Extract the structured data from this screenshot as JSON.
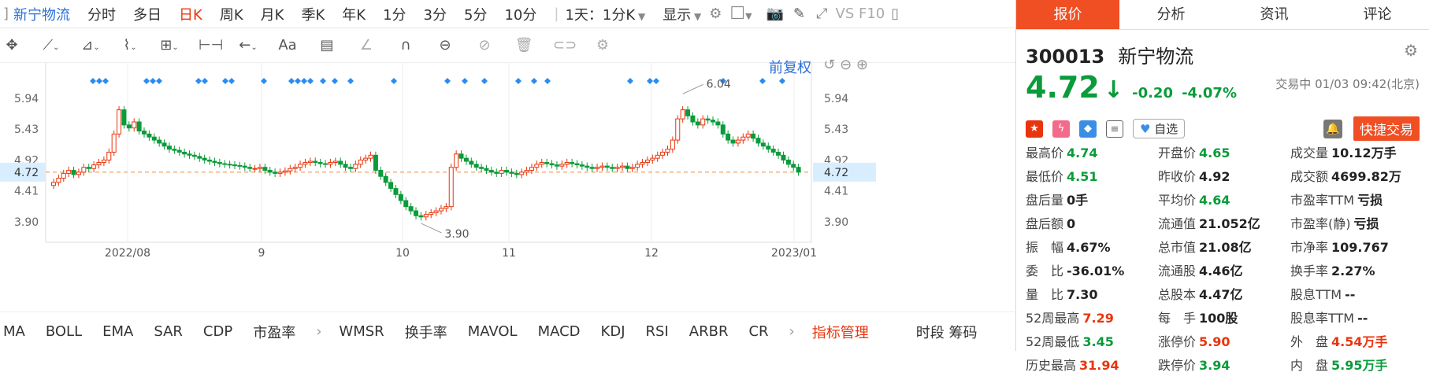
{
  "toolbar1": {
    "stock_name": "新宁物流",
    "items": [
      "分时",
      "多日",
      "日K",
      "周K",
      "月K",
      "季K",
      "年K",
      "1分",
      "3分",
      "5分",
      "10分",
      "1天：1分K",
      "显示"
    ],
    "active": "日K",
    "vs_label": "VS F10"
  },
  "toolbar2": {
    "aa_label": "Aa"
  },
  "chart_top": {
    "restore_label": "前复权"
  },
  "bottom": {
    "items": [
      "MA",
      "BOLL",
      "EMA",
      "SAR",
      "CDP",
      "市盈率",
      "›",
      "WMSR",
      "换手率",
      "MAVOL",
      "MACD",
      "KDJ",
      "RSI",
      "ARBR",
      "CR",
      "›",
      "指标管理",
      "时段 筹码"
    ]
  },
  "chart_data": {
    "type": "candlestick",
    "y_ticks": [
      "5.94",
      "5.43",
      "4.92",
      "4.41",
      "3.90"
    ],
    "current_price": "4.72",
    "x_labels": [
      "2022/08",
      "9",
      "10",
      "11",
      "12",
      "2023/01"
    ],
    "high_label": "6.04",
    "low_label": "3.90",
    "ylim": [
      3.6,
      6.2
    ]
  },
  "right": {
    "tabs": [
      "报价",
      "分析",
      "资讯",
      "评论"
    ],
    "code": "300013",
    "name": "新宁物流",
    "price": "4.72",
    "arrow": "↓",
    "change": "-0.20",
    "pct": "-4.07%",
    "status": "交易中 01/03 09:42(北京)",
    "fav": "自选",
    "quick": "快捷交易",
    "grid": [
      [
        [
          "最高价",
          "4.74",
          "g"
        ],
        [
          "开盘价",
          "4.65",
          "g"
        ],
        [
          "成交量",
          "10.12万手",
          "d"
        ]
      ],
      [
        [
          "最低价",
          "4.51",
          "g"
        ],
        [
          "昨收价",
          "4.92",
          "d"
        ],
        [
          "成交额",
          "4699.82万",
          "d"
        ]
      ],
      [
        [
          "盘后量",
          "0手",
          "d"
        ],
        [
          "平均价",
          "4.64",
          "g"
        ],
        [
          "市盈率TTM",
          "亏损",
          "d"
        ]
      ],
      [
        [
          "盘后额",
          "0",
          "d"
        ],
        [
          "流通值",
          "21.052亿",
          "d"
        ],
        [
          "市盈率(静)",
          "亏损",
          "d"
        ]
      ],
      [
        [
          "振　幅",
          "4.67%",
          "d"
        ],
        [
          "总市值",
          "21.08亿",
          "d"
        ],
        [
          "市净率",
          "109.767",
          "d"
        ]
      ],
      [
        [
          "委　比",
          "-36.01%",
          "d"
        ],
        [
          "流通股",
          "4.46亿",
          "d"
        ],
        [
          "换手率",
          "2.27%",
          "d"
        ]
      ],
      [
        [
          "量　比",
          "7.30",
          "d"
        ],
        [
          "总股本",
          "4.47亿",
          "d"
        ],
        [
          "股息TTM",
          "--",
          "d"
        ]
      ],
      [
        [
          "52周最高",
          "7.29",
          "r"
        ],
        [
          "每　手",
          "100股",
          "d"
        ],
        [
          "股息率TTM",
          "--",
          "d"
        ]
      ],
      [
        [
          "52周最低",
          "3.45",
          "g"
        ],
        [
          "涨停价",
          "5.90",
          "r"
        ],
        [
          "外　盘",
          "4.54万手",
          "r"
        ]
      ],
      [
        [
          "历史最高",
          "31.94",
          "r"
        ],
        [
          "跌停价",
          "3.94",
          "g"
        ],
        [
          "内　盘",
          "5.95万手",
          "g"
        ]
      ]
    ]
  }
}
